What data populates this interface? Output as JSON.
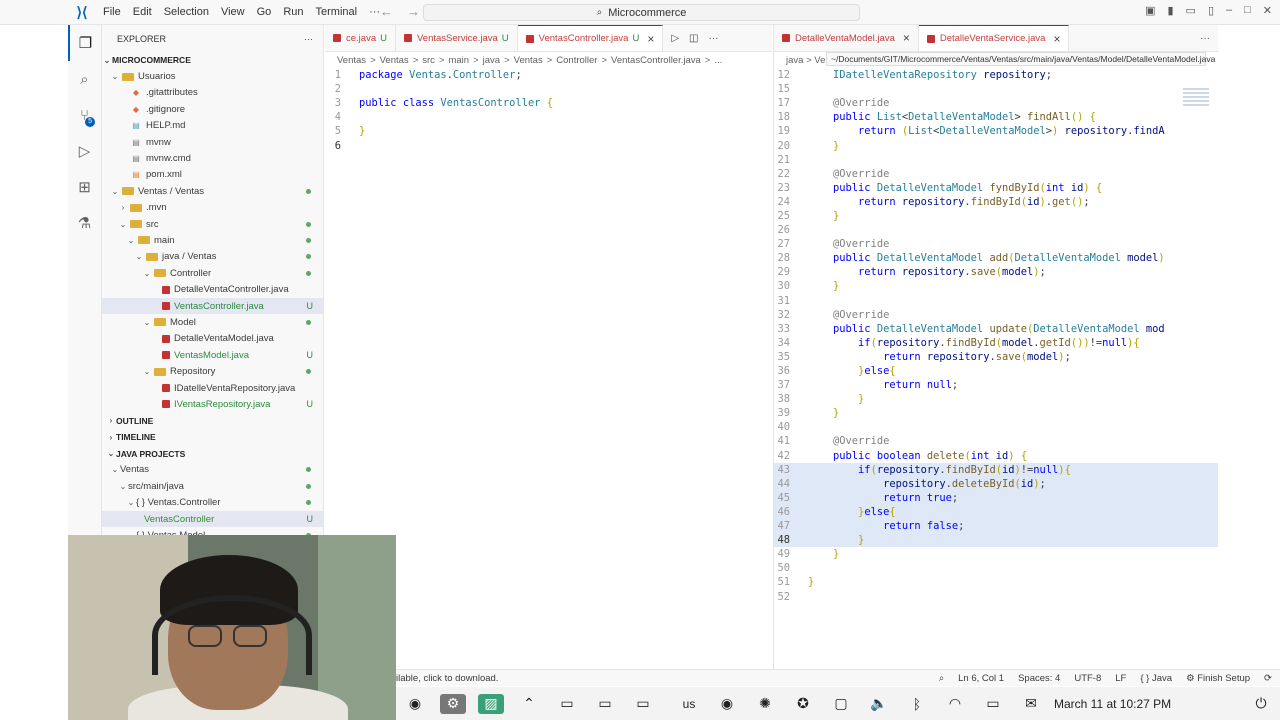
{
  "titlebar": {
    "menu": [
      "File",
      "Edit",
      "Selection",
      "View",
      "Go",
      "Run",
      "Terminal",
      "···"
    ],
    "search_text": "Microcommerce"
  },
  "sidebar": {
    "header": "EXPLORER",
    "more": "···",
    "project": "MICROCOMMERCE",
    "tree": [
      {
        "label": "Usuarios",
        "indent": 1,
        "chev": "v",
        "icon": "folder",
        "status": ""
      },
      {
        "label": ".gitattributes",
        "indent": 2,
        "chev": "",
        "icon": "git",
        "status": ""
      },
      {
        "label": ".gitignore",
        "indent": 2,
        "chev": "",
        "icon": "git",
        "status": ""
      },
      {
        "label": "HELP.md",
        "indent": 2,
        "chev": "",
        "icon": "md",
        "status": ""
      },
      {
        "label": "mvnw",
        "indent": 2,
        "chev": "",
        "icon": "file",
        "status": ""
      },
      {
        "label": "mvnw.cmd",
        "indent": 2,
        "chev": "",
        "icon": "file",
        "status": ""
      },
      {
        "label": "pom.xml",
        "indent": 2,
        "chev": "",
        "icon": "xml",
        "status": ""
      },
      {
        "label": "Ventas / Ventas",
        "indent": 1,
        "chev": "v",
        "icon": "folder",
        "status": "dot"
      },
      {
        "label": ".mvn",
        "indent": 2,
        "chev": ">",
        "icon": "folder",
        "status": ""
      },
      {
        "label": "src",
        "indent": 2,
        "chev": "v",
        "icon": "folder",
        "status": "dot"
      },
      {
        "label": "main",
        "indent": 3,
        "chev": "v",
        "icon": "folder",
        "status": "dot"
      },
      {
        "label": "java / Ventas",
        "indent": 4,
        "chev": "v",
        "icon": "folder",
        "status": "dot"
      },
      {
        "label": "Controller",
        "indent": 5,
        "chev": "v",
        "icon": "folder",
        "status": "dot"
      },
      {
        "label": "DetalleVentaController.java",
        "indent": 6,
        "chev": "",
        "icon": "java",
        "status": ""
      },
      {
        "label": "VentasController.java",
        "indent": 6,
        "chev": "",
        "icon": "java",
        "status": "U",
        "selected": true
      },
      {
        "label": "Model",
        "indent": 5,
        "chev": "v",
        "icon": "folder",
        "status": "dot"
      },
      {
        "label": "DetalleVentaModel.java",
        "indent": 6,
        "chev": "",
        "icon": "java",
        "status": ""
      },
      {
        "label": "VentasModel.java",
        "indent": 6,
        "chev": "",
        "icon": "java",
        "status": "U"
      },
      {
        "label": "Repository",
        "indent": 5,
        "chev": "v",
        "icon": "folder",
        "status": "dot"
      },
      {
        "label": "IDatelleVentaRepository.java",
        "indent": 6,
        "chev": "",
        "icon": "java",
        "status": ""
      },
      {
        "label": "IVentasRepository.java",
        "indent": 6,
        "chev": "",
        "icon": "java",
        "status": "U"
      }
    ],
    "outline": "OUTLINE",
    "timeline": "TIMELINE",
    "java_projects": "JAVA PROJECTS",
    "java_tree": [
      {
        "label": "Ventas",
        "indent": 1,
        "chev": "v",
        "status": "dot"
      },
      {
        "label": "src/main/java",
        "indent": 2,
        "chev": "v",
        "status": "dot"
      },
      {
        "label": "{ } Ventas.Controller",
        "indent": 3,
        "chev": "v",
        "status": "dot"
      },
      {
        "label": "VentasController",
        "indent": 4,
        "chev": "",
        "status": "U",
        "selected": true
      },
      {
        "label": "{ } Ventas.Model",
        "indent": 3,
        "chev": "v",
        "status": "dot"
      }
    ]
  },
  "editor1": {
    "tabs": [
      {
        "label": "ce.java",
        "status": "U",
        "active": false
      },
      {
        "label": "VentasService.java",
        "status": "U",
        "active": false
      },
      {
        "label": "VentasController.java",
        "status": "U",
        "active": true
      }
    ],
    "breadcrumb": [
      "Ventas",
      ">",
      "Ventas",
      ">",
      "src",
      ">",
      "main",
      ">",
      "java",
      ">",
      "Ventas",
      ">",
      "Controller",
      ">",
      "VentasController.java",
      ">",
      "..."
    ],
    "lines": [
      {
        "n": "1",
        "text": "package Ventas.Controller;"
      },
      {
        "n": "2",
        "text": ""
      },
      {
        "n": "3",
        "text": "public class VentasController {"
      },
      {
        "n": "4",
        "text": ""
      },
      {
        "n": "5",
        "text": "}"
      },
      {
        "n": "6",
        "text": ""
      }
    ]
  },
  "editor2": {
    "tabs": [
      {
        "label": "DetalleVentaModel.java",
        "active": false
      },
      {
        "label": "DetalleVentaService.java",
        "active": true
      }
    ],
    "breadcrumb": "java > Ven",
    "tooltip": "~/Documents/GIT/Microcommerce/Ventas/Ventas/src/main/java/Ventas/Model/DetalleVentaModel.java",
    "lines": [
      {
        "n": "12",
        "text": "    IDatelleVentaRepository repository;"
      },
      {
        "n": "15",
        "text": ""
      },
      {
        "n": "17",
        "text": "    @Override"
      },
      {
        "n": "18",
        "text": "    public List<DetalleVentaModel> findAll() {"
      },
      {
        "n": "19",
        "text": "        return (List<DetalleVentaModel>) repository.findA"
      },
      {
        "n": "20",
        "text": "    }"
      },
      {
        "n": "21",
        "text": ""
      },
      {
        "n": "22",
        "text": "    @Override"
      },
      {
        "n": "23",
        "text": "    public DetalleVentaModel fyndById(int id) {"
      },
      {
        "n": "24",
        "text": "        return repository.findById(id).get();"
      },
      {
        "n": "25",
        "text": "    }"
      },
      {
        "n": "26",
        "text": ""
      },
      {
        "n": "27",
        "text": "    @Override"
      },
      {
        "n": "28",
        "text": "    public DetalleVentaModel add(DetalleVentaModel model)"
      },
      {
        "n": "29",
        "text": "        return repository.save(model);"
      },
      {
        "n": "30",
        "text": "    }"
      },
      {
        "n": "31",
        "text": ""
      },
      {
        "n": "32",
        "text": "    @Override"
      },
      {
        "n": "33",
        "text": "    public DetalleVentaModel update(DetalleVentaModel mod"
      },
      {
        "n": "34",
        "text": "        if(repository.findById(model.getId())!=null){"
      },
      {
        "n": "35",
        "text": "            return repository.save(model);"
      },
      {
        "n": "36",
        "text": "        }else{"
      },
      {
        "n": "37",
        "text": "            return null;"
      },
      {
        "n": "38",
        "text": "        }"
      },
      {
        "n": "39",
        "text": "    }"
      },
      {
        "n": "40",
        "text": ""
      },
      {
        "n": "41",
        "text": "    @Override"
      },
      {
        "n": "42",
        "text": "    public boolean delete(int id) {"
      },
      {
        "n": "43",
        "text": "        if(repository.findById(id)!=null){",
        "hl": true
      },
      {
        "n": "44",
        "text": "            repository.deleteById(id);",
        "hl": true
      },
      {
        "n": "45",
        "text": "            return true;",
        "hl": true
      },
      {
        "n": "46",
        "text": "        }else{",
        "hl": true
      },
      {
        "n": "47",
        "text": "            return false;",
        "hl": true
      },
      {
        "n": "48",
        "text": "        }",
        "hl": true
      },
      {
        "n": "49",
        "text": "    }"
      },
      {
        "n": "50",
        "text": ""
      },
      {
        "n": "51",
        "text": "}"
      },
      {
        "n": "52",
        "text": ""
      }
    ]
  },
  "status": {
    "left_msg": "ilable, click to download.",
    "position": "Ln 6, Col 1",
    "spaces": "Spaces: 4",
    "encoding": "UTF-8",
    "eol": "LF",
    "language": "{ } Java",
    "finish_setup": "Finish Setup"
  },
  "taskbar": {
    "keyboard": "us",
    "datetime": "March 11 at 10:27 PM"
  },
  "colors": {
    "accent": "#005fb8",
    "java_icon": "#c23434",
    "untracked": "#2a8a3e"
  }
}
